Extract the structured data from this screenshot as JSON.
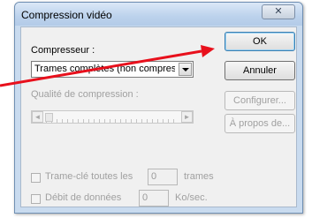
{
  "window": {
    "title": "Compression vidéo",
    "close_symbol": "✕"
  },
  "compressor": {
    "label": "Compresseur :",
    "selected": "Trames complètes (non compressées)"
  },
  "quality": {
    "label": "Qualité de compression :",
    "slider_left_arrow": "◄",
    "slider_right_arrow": "►"
  },
  "buttons": {
    "ok": "OK",
    "cancel": "Annuler",
    "configure": "Configurer...",
    "about": "À propos de..."
  },
  "keyframe": {
    "label": "Trame-clé toutes les",
    "value": "0",
    "unit": "trames"
  },
  "datarate": {
    "label": "Débit de données",
    "value": "0",
    "unit": "Ko/sec."
  },
  "annotation": {
    "arrow_color": "#e8101c"
  }
}
